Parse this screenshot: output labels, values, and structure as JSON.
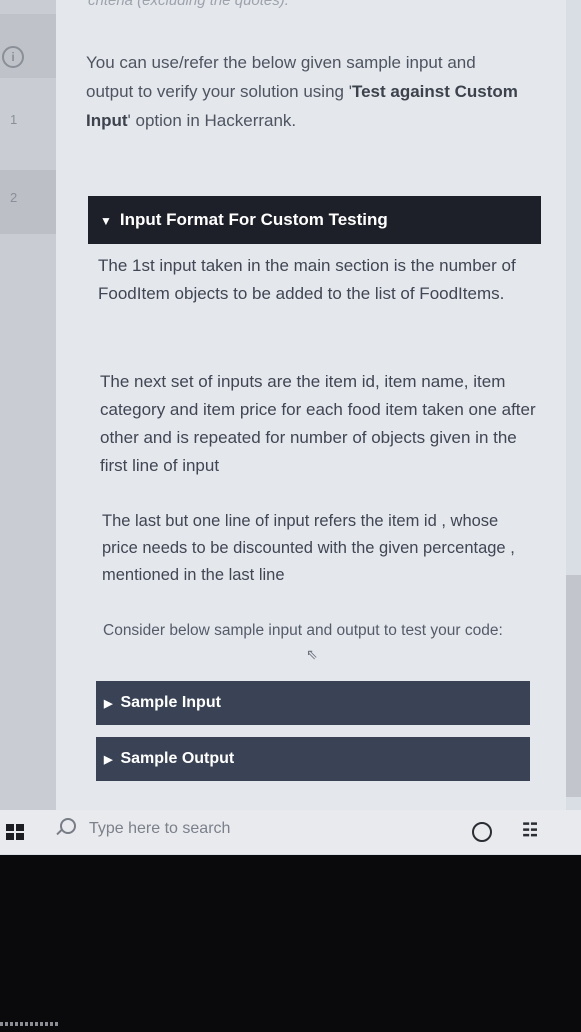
{
  "header": {
    "truncated_text": "criteria (excluding the quotes)."
  },
  "sidebar": {
    "items": [
      {
        "label": "1"
      },
      {
        "label": "2"
      }
    ]
  },
  "intro": {
    "line1": "You can use/refer the below given sample input",
    "line2_prefix": "and output to verify your solution using ",
    "quote_open": "'",
    "bold_text": "Test against Custom Input",
    "quote_close": "'",
    "line_suffix": " option in Hackerrank."
  },
  "input_format": {
    "title": "Input Format For Custom Testing",
    "paragraphs": [
      "The 1st input taken in the main section is the number of FoodItem objects to be added to the list of FoodItems.",
      "The next set of inputs are the item id, item name, item category and item price for each food item taken one after other and is repeated for number of objects given in the first line of input",
      "The last but one line of input refers the item id , whose price needs to be discounted with the given percentage , mentioned in the last line",
      "Consider below sample input and output to test your code:"
    ]
  },
  "sections": {
    "sample_input": "Sample Input",
    "sample_output": "Sample Output"
  },
  "taskbar": {
    "search_placeholder": "Type here to search"
  },
  "icons": {
    "collapse_triangle": "▼",
    "expand_triangle": "▶"
  }
}
